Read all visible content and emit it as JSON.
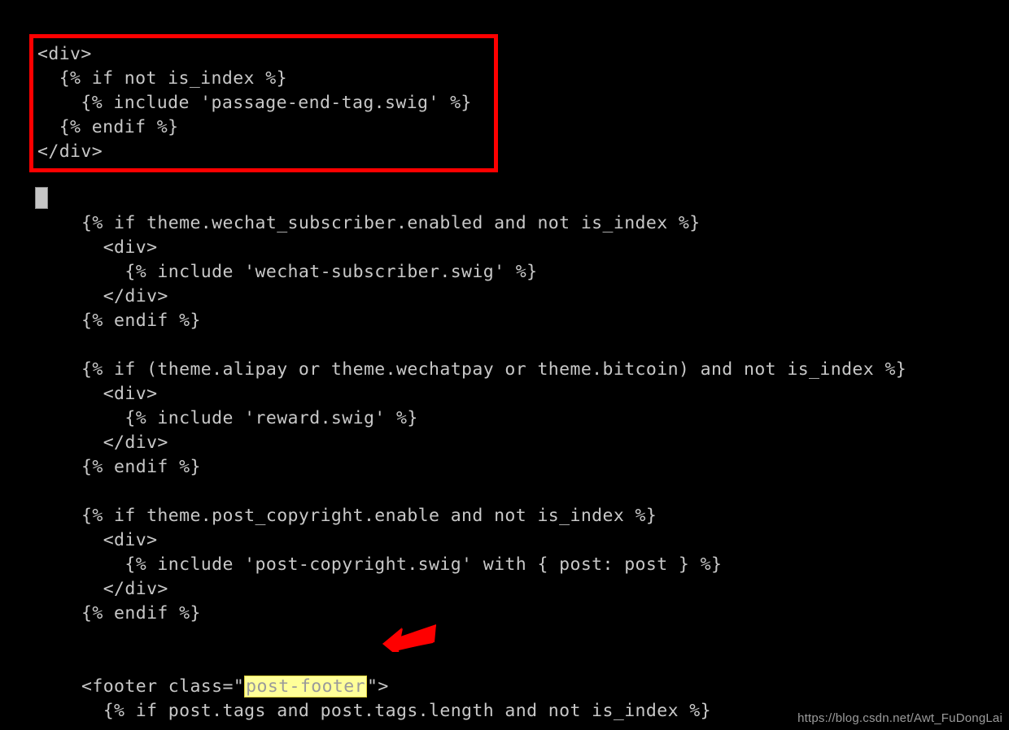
{
  "editor": {
    "background_color": "#000000",
    "text_color": "#c8c8c8",
    "cursor_color": "#c6c6c6",
    "annotation_color": "#fe0000",
    "highlight_background": "#ffff99",
    "highlight_text_color": "#9a9a9a"
  },
  "code_block_top": {
    "lines": [
      "<div>",
      "  {% if not is_index %}",
      "    {% include 'passage-end-tag.swig' %}",
      "  {% endif %}",
      "</div>"
    ]
  },
  "code_block_main": {
    "lines": [
      "{% if theme.wechat_subscriber.enabled and not is_index %}",
      "  <div>",
      "    {% include 'wechat-subscriber.swig' %}",
      "  </div>",
      "{% endif %}",
      "",
      "{% if (theme.alipay or theme.wechatpay or theme.bitcoin) and not is_index %}",
      "  <div>",
      "    {% include 'reward.swig' %}",
      "  </div>",
      "{% endif %}",
      "",
      "{% if theme.post_copyright.enable and not is_index %}",
      "  <div>",
      "    {% include 'post-copyright.swig' with { post: post } %}",
      "  </div>",
      "{% endif %}",
      "",
      "",
      "",
      "",
      "  {% if post.tags and post.tags.length and not is_index %}"
    ],
    "footer_line": {
      "prefix": "<footer class=\"",
      "highlighted": "post-footer",
      "suffix": "\">"
    }
  },
  "annotations": {
    "red_box_label": "red-rectangle-annotation",
    "red_arrow_label": "red-arrow-annotation",
    "yellow_highlight_label": "post-footer"
  },
  "watermark": {
    "text": "https://blog.csdn.net/Awt_FuDongLai"
  }
}
